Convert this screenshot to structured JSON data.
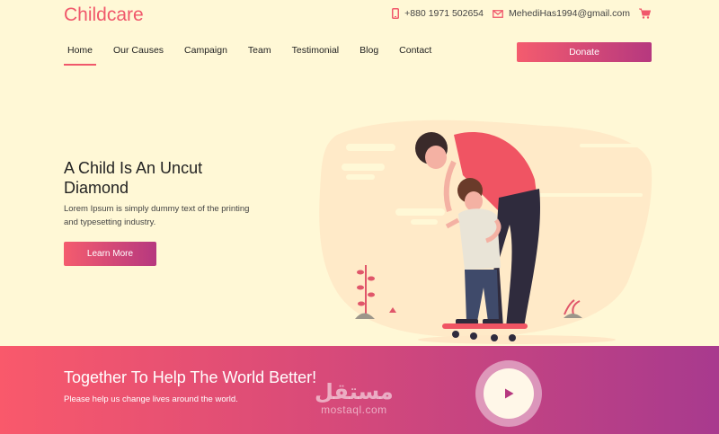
{
  "header": {
    "logo": "Childcare",
    "phone": "+880 1971 502654",
    "email": "MehediHas1994@gmail.com"
  },
  "nav": {
    "items": [
      {
        "label": "Home",
        "active": true
      },
      {
        "label": "Our Causes"
      },
      {
        "label": "Campaign"
      },
      {
        "label": "Team"
      },
      {
        "label": "Testimonial"
      },
      {
        "label": "Blog"
      },
      {
        "label": "Contact"
      }
    ],
    "donate_label": "Donate"
  },
  "hero": {
    "title_line1": "A Child Is An Uncut",
    "title_line2": "Diamond",
    "text_line1": "Lorem Ipsum is simply dummy text of the printing",
    "text_line2": "and typesetting industry.",
    "button_label": "Learn More"
  },
  "banner": {
    "title": "Together To Help The World Better!",
    "subtitle": "Please help us change lives around the world."
  },
  "watermark": {
    "arabic": "مستقل",
    "latin": "mostaql.com"
  },
  "colors": {
    "accent": "#f0586b",
    "gradient_start": "#f9596b",
    "gradient_end": "#a83a8e",
    "background": "#fff8d6"
  }
}
